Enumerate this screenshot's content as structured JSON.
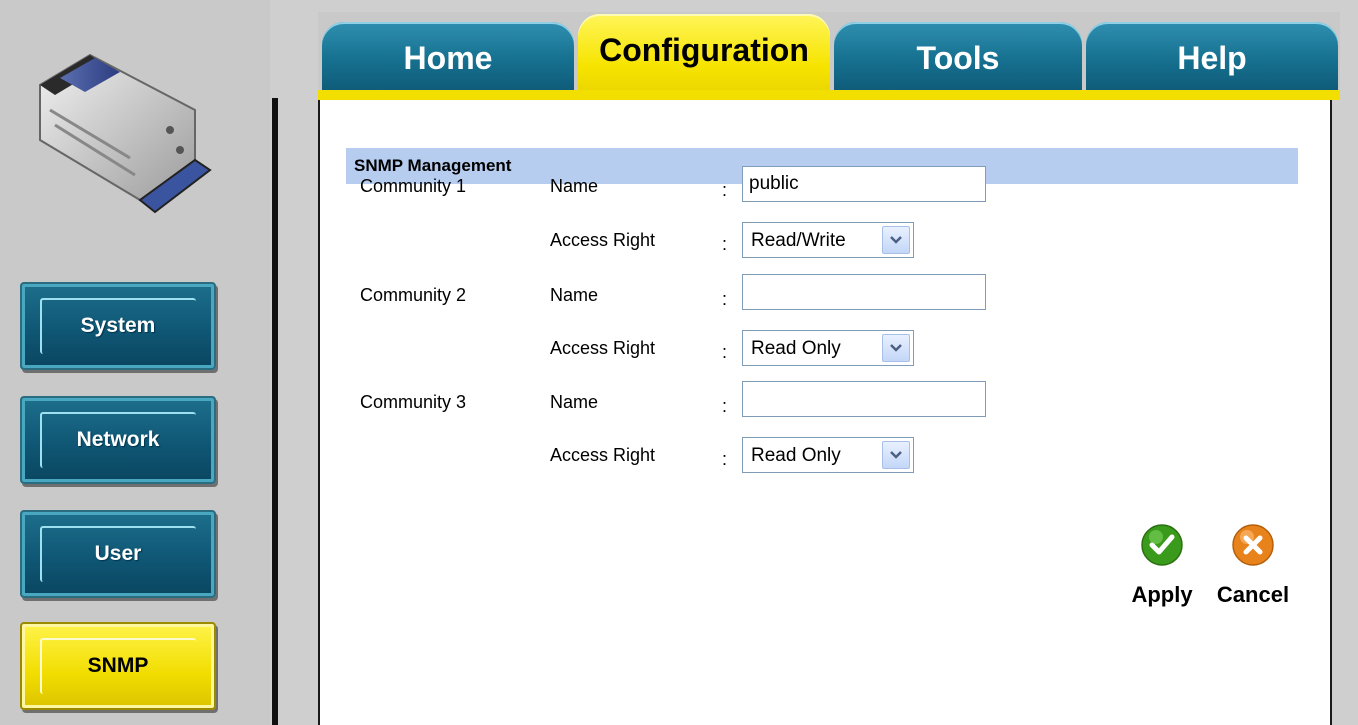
{
  "tabs": [
    {
      "label": "Home"
    },
    {
      "label": "Configuration"
    },
    {
      "label": "Tools"
    },
    {
      "label": "Help"
    }
  ],
  "active_tab": "Configuration",
  "sidebar": {
    "items": [
      {
        "label": "System"
      },
      {
        "label": "Network"
      },
      {
        "label": "User"
      },
      {
        "label": "SNMP"
      }
    ],
    "active": "SNMP"
  },
  "section": {
    "title": "SNMP Management"
  },
  "form": {
    "name_label": "Name",
    "access_label": "Access Right",
    "colon": ":",
    "communities": [
      {
        "label": "Community 1",
        "name": "public",
        "access": "Read/Write"
      },
      {
        "label": "Community 2",
        "name": "",
        "access": "Read Only"
      },
      {
        "label": "Community 3",
        "name": "",
        "access": "Read Only"
      }
    ],
    "access_options": [
      "Read Only",
      "Read/Write"
    ]
  },
  "actions": {
    "apply_label": "Apply",
    "cancel_label": "Cancel"
  },
  "colors": {
    "tab_blue": "#16708f",
    "active_yellow": "#f6e400",
    "section_bar": "#b7cdf0",
    "apply_green": "#3a9a1c",
    "cancel_orange": "#e8831c"
  }
}
